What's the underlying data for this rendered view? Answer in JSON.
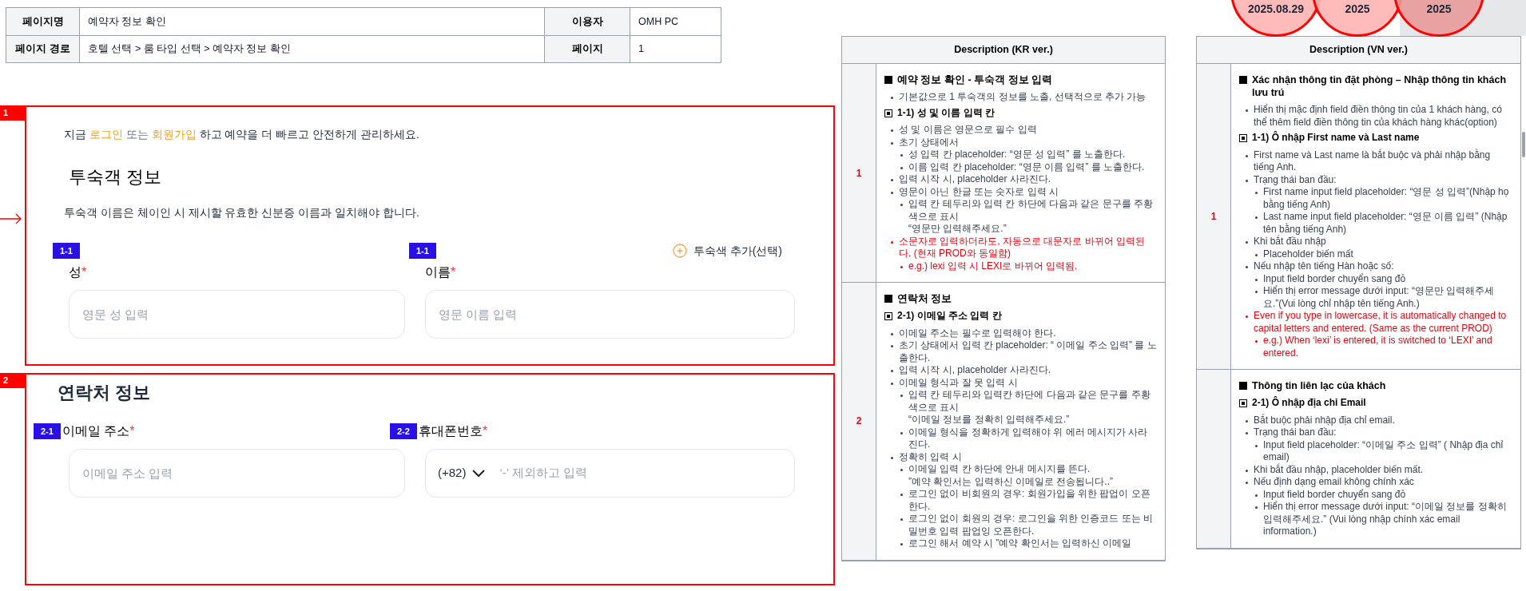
{
  "info_table": [
    [
      {
        "label": "페이지명",
        "value": "예약자 정보 확인"
      },
      {
        "label": "이용자",
        "value": "OMH PC"
      }
    ],
    [
      {
        "label": "페이지 경로",
        "value": "호텔 선택 > 룸 타입 선택 > 예약자 정보 확인"
      },
      {
        "label": "페이지",
        "value": "1"
      }
    ]
  ],
  "notice": {
    "before": "지금",
    "link1": "로그인",
    "middle": "또는",
    "link2": "회원가입",
    "after": "하고 예약을 더 빠르고 안전하게 관리하세요."
  },
  "sections": [
    {
      "marker": "1",
      "arrow": true,
      "title": "투숙객 정보",
      "note": "투숙객 이름은 체이인 시 제시할 유효한 신분증 이름과 일치해야 합니다.",
      "kind": "stacked",
      "add_button": "투숙색 추가(선택)",
      "fields": [
        {
          "badge": "1-1",
          "label": "성",
          "mark": "*",
          "placeholder": "영문 성 입력"
        },
        {
          "badge": "1-1",
          "label": "이름",
          "mark": "*",
          "placeholder": "영문 이름 입력"
        }
      ]
    },
    {
      "marker": "2",
      "arrow": false,
      "title": "연락처 정보",
      "kind": "inline",
      "fields": [
        {
          "badge": "2-1",
          "label": "이메일 주소",
          "mark": "*",
          "placeholder": "이메일 주소 입력"
        },
        {
          "badge": "2-2",
          "label": "휴대폰번호",
          "mark": "*",
          "prefix": "(+82)",
          "placeholder": "‘-’ 제외하고 입력"
        }
      ]
    }
  ],
  "stamps": [
    {
      "text": "2025.08.29"
    },
    {
      "text": "2025"
    },
    {
      "text": "2025"
    }
  ],
  "descriptions": [
    {
      "title": "Description (KR ver.)",
      "rows": [
        {
          "number": "1",
          "blocks": [
            {
              "kind": "heading",
              "text": "예약 정보 확인 - 투숙객 정보  입력"
            },
            {
              "kind": "list",
              "items": [
                {
                  "text": "기본값으로 1 투숙객의 정보를 노출, 선택적으로 추가 가능",
                  "highlight": false
                }
              ]
            },
            {
              "kind": "subheading",
              "text": "1-1) 성 및 이름 입력 칸"
            },
            {
              "kind": "list",
              "items": [
                {
                  "text": "성 및 이름은 영문으로 필수 입력",
                  "highlight": false
                },
                {
                  "text": "초기 상태에서",
                  "highlight": false,
                  "children": [
                    {
                      "text": "성 입력 칸 placeholder:  “영문 성 입력” 를 노출한다.",
                      "highlight": false
                    },
                    {
                      "text": "이름 입력 칸 placeholder:  “영문 이름 입력” 를 노출한다.",
                      "highlight": false
                    }
                  ]
                },
                {
                  "text": "입력 시작 시, placeholder 사라진다.",
                  "highlight": false
                },
                {
                  "text": "영문이 아닌 한글 또는 숫자로 입력 시",
                  "highlight": false,
                  "children": [
                    {
                      "text": "입력 칸 테두리와 입력 칸 하단에 다음과 같은 문구를 주황색으로 표시\n“영문만 입력해주세요.”",
                      "highlight": false
                    }
                  ]
                },
                {
                  "text": "소문자로 입력하더라도, 자동으로 대문자로 바뀌어 입력된다. (현재 PROD와 동일함)",
                  "highlight": true,
                  "children": [
                    {
                      "text": "e.g.) lexi 입력 시 LEXI로 바뀌어 입력됨.",
                      "highlight": true
                    }
                  ]
                }
              ]
            }
          ]
        },
        {
          "number": "2",
          "blocks": [
            {
              "kind": "heading",
              "text": "연락처 정보"
            },
            {
              "kind": "subheading",
              "text": "2-1) 이메일 주소 입력 칸"
            },
            {
              "kind": "list",
              "items": [
                {
                  "text": "이메일 주소는 필수로 입력해야 한다.",
                  "highlight": false
                },
                {
                  "text": "초기 상태에서 입력 칸 placeholder:  “ 이메일 주소  입력” 를 노출한다.",
                  "highlight": false
                },
                {
                  "text": "입력 시작 시, placeholder 사라진다.",
                  "highlight": false
                },
                {
                  "text": "이메일 형식과 잘 못 입력 시",
                  "highlight": false,
                  "children": [
                    {
                      "text": "입력 칸 테두리와 입력칸 하단에 다음과 같은 문구를 주황색으로 표시\n “이메일 정보를 정확히 입력해주세요.”",
                      "highlight": false
                    },
                    {
                      "text": "이메일 형식을 정확하게 입력해야 위 에러 메시지가 사라진다.",
                      "highlight": false
                    }
                  ]
                },
                {
                  "text": "정확히 입력 시",
                  "highlight": false,
                  "children": [
                    {
                      "text": "이메일 입력 칸 하단에 안내 메시지를 뜬다.\n”예약 확인서는 입력하신 이메일로 전송됩니다..”",
                      "highlight": false
                    },
                    {
                      "text": "로그인 없이 비회원의 경우: 회원가입을 위한 팝업이 오픈한다.",
                      "highlight": false
                    },
                    {
                      "text": "로그인 없이 회원의 경우: 로그인을 위한 인증코드 또는 비밀번호 입력 팝업잉 오픈한다.",
                      "highlight": false
                    },
                    {
                      "text": "로그인 해서 예약 시 ”예약 확인서는 입력하신 이메일",
                      "highlight": false
                    }
                  ]
                }
              ]
            }
          ]
        }
      ]
    },
    {
      "title": "Description (VN ver.)",
      "rows": [
        {
          "number": "1",
          "blocks": [
            {
              "kind": "heading",
              "text": "Xác nhận thông tin đặt phòng – Nhập thông tin khách lưu trú"
            },
            {
              "kind": "list",
              "items": [
                {
                  "text": "Hiển thị mặc định field điền thông tin của 1 khách hàng, có thể thêm field điền thông tin của khách hàng khác(option)",
                  "highlight": false
                }
              ]
            },
            {
              "kind": "subheading",
              "text": "1-1)  Ô nhập First name và Last name"
            },
            {
              "kind": "list",
              "items": [
                {
                  "text": "First name và Last name là bắt buộc và phải nhập bằng tiếng Anh.",
                  "highlight": false
                },
                {
                  "text": "Trạng thái ban đầu:",
                  "highlight": false,
                  "children": [
                    {
                      "text": "First name input field placeholder: “영문 성 입력”(Nhập họ bằng tiếng Anh)",
                      "highlight": false
                    },
                    {
                      "text": "Last name input field placeholder: “영문 이름 입력” (Nhập tên bằng tiếng Anh)",
                      "highlight": false
                    }
                  ]
                },
                {
                  "text": "Khi bắt đầu nhập",
                  "highlight": false,
                  "children": [
                    {
                      "text": "Placeholder biến mất",
                      "highlight": false
                    }
                  ]
                },
                {
                  "text": "Nếu nhập tên tiếng Hàn hoặc số:",
                  "highlight": false,
                  "children": [
                    {
                      "text": "Input field border chuyển sang đỏ",
                      "highlight": false
                    },
                    {
                      "text": "Hiển thị error message dưới input: “영문만 입력해주세요.”(Vui lòng chỉ nhập tên tiếng Anh.)",
                      "highlight": false
                    }
                  ]
                },
                {
                  "text": "Even if you type in lowercase, it is automatically changed to capital letters and entered. (Same as the current PROD)",
                  "highlight": true,
                  "children": [
                    {
                      "text": "e.g.) When ‘lexi’ is entered, it is switched to ‘LEXI’ and entered.",
                      "highlight": true
                    }
                  ]
                }
              ]
            }
          ]
        },
        {
          "blocks": [
            {
              "kind": "heading",
              "text": "Thông tin liên lạc của khách"
            },
            {
              "kind": "subheading",
              "text": "2-1)  Ô nhập địa chỉ Email"
            },
            {
              "kind": "list",
              "items": [
                {
                  "text": "Bắt buộc phải nhập địa chỉ email.",
                  "highlight": false
                },
                {
                  "text": "Trạng thái ban đầu:",
                  "highlight": false,
                  "children": [
                    {
                      "text": "Input field placeholder: “이메일 주소  입력” ( Nhập địa chỉ email)",
                      "highlight": false
                    }
                  ]
                },
                {
                  "text": "Khi bắt đầu nhập, placeholder biến mất.",
                  "highlight": false
                },
                {
                  "text": "Nếu định dạng email không chính xác",
                  "highlight": false,
                  "children": [
                    {
                      "text": "Input field border chuyển sang đỏ",
                      "highlight": false
                    },
                    {
                      "text": "Hiển thị error message dưới input: “이메일 정보를 정확히 입력해주세요.” (Vui lòng nhập chính xác email information.)",
                      "highlight": false
                    }
                  ]
                }
              ]
            }
          ]
        }
      ]
    }
  ]
}
